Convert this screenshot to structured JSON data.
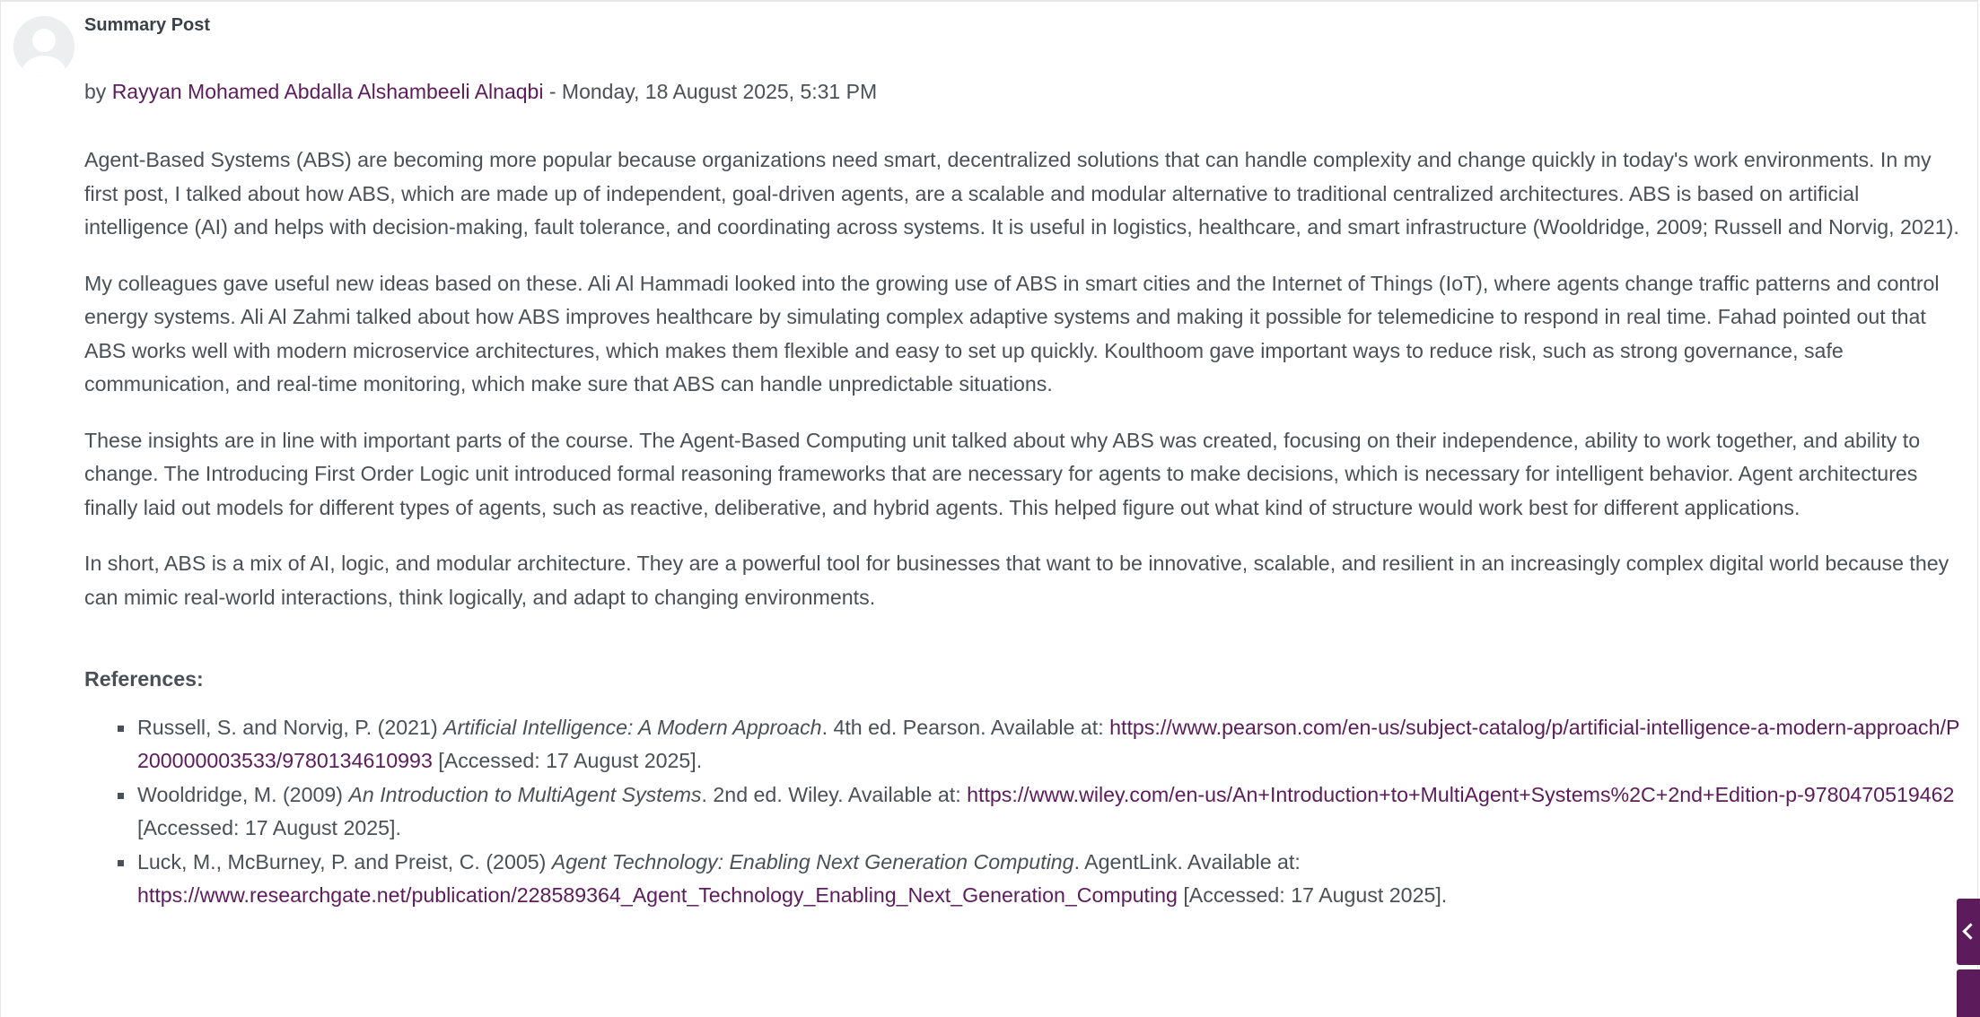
{
  "post": {
    "subject": "Summary Post",
    "by_prefix": "by",
    "author": "Rayyan Mohamed Abdalla Alshambeeli Alnaqbi",
    "date_separator": " - ",
    "date": "Monday, 18 August 2025, 5:31 PM",
    "paragraphs": [
      "Agent-Based Systems (ABS) are becoming more popular because organizations need smart, decentralized solutions that can handle complexity and change quickly in today's work environments. In my first post, I talked about how ABS, which are made up of independent, goal-driven agents, are a scalable and modular alternative to traditional centralized architectures. ABS is based on artificial intelligence (AI) and helps with decision-making, fault tolerance, and coordinating across systems. It is useful in logistics, healthcare, and smart infrastructure (Wooldridge, 2009; Russell and Norvig, 2021).",
      "My colleagues gave useful new ideas based on these. Ali Al Hammadi looked into the growing use of ABS in smart cities and the Internet of Things (IoT), where agents change traffic patterns and control energy systems. Ali Al Zahmi talked about how ABS improves healthcare by simulating complex adaptive systems and making it possible for telemedicine to respond in real time. Fahad pointed out that ABS works well with modern microservice architectures, which makes them flexible and easy to set up quickly. Koulthoom gave important ways to reduce risk, such as strong governance, safe communication, and real-time monitoring, which make sure that ABS can handle unpredictable situations.",
      "These insights are in line with important parts of the course. The Agent-Based Computing unit talked about why ABS was created, focusing on their independence, ability to work together, and ability to change. The Introducing First Order Logic unit introduced formal reasoning frameworks that are necessary for agents to make decisions, which is necessary for intelligent behavior. Agent architectures finally laid out models for different types of agents, such as reactive, deliberative, and hybrid agents. This helped figure out what kind of structure would work best for different applications.",
      "In short, ABS is a mix of AI, logic, and modular architecture. They are a powerful tool for businesses that want to be innovative, scalable, and resilient in an increasingly complex digital world because they can mimic real-world interactions, think logically, and adapt to changing environments."
    ],
    "references_heading": "References:",
    "references": [
      {
        "authors": "Russell, S. and Norvig, P. (2021) ",
        "title": "Artificial Intelligence: A Modern Approach",
        "details": ". 4th ed. Pearson. Available at: ",
        "url": "https://www.pearson.com/en-us/subject-catalog/p/artificial-intelligence-a-modern-approach/P200000003533/9780134610993",
        "accessed": " [Accessed: 17 August 2025]."
      },
      {
        "authors": "Wooldridge, M. (2009) ",
        "title": "An Introduction to MultiAgent Systems",
        "details": ". 2nd ed. Wiley. Available at: ",
        "url": "https://www.wiley.com/en-us/An+Introduction+to+MultiAgent+Systems%2C+2nd+Edition-p-9780470519462",
        "accessed": " [Accessed: 17 August 2025]."
      },
      {
        "authors": "Luck, M., McBurney, P. and Preist, C. (2005) ",
        "title": "Agent Technology: Enabling Next Generation Computing",
        "details": ". AgentLink. Available at: ",
        "url": "https://www.researchgate.net/publication/228589364_Agent_Technology_Enabling_Next_Generation_Computing",
        "accessed": " [Accessed: 17 August 2025]."
      }
    ]
  },
  "icons": {
    "avatar": "default-user-icon",
    "side_toggle": "chevron-left-icon"
  },
  "colors": {
    "text": "#495057",
    "link": "#5c1c5c",
    "accent": "#5c1c5c"
  }
}
